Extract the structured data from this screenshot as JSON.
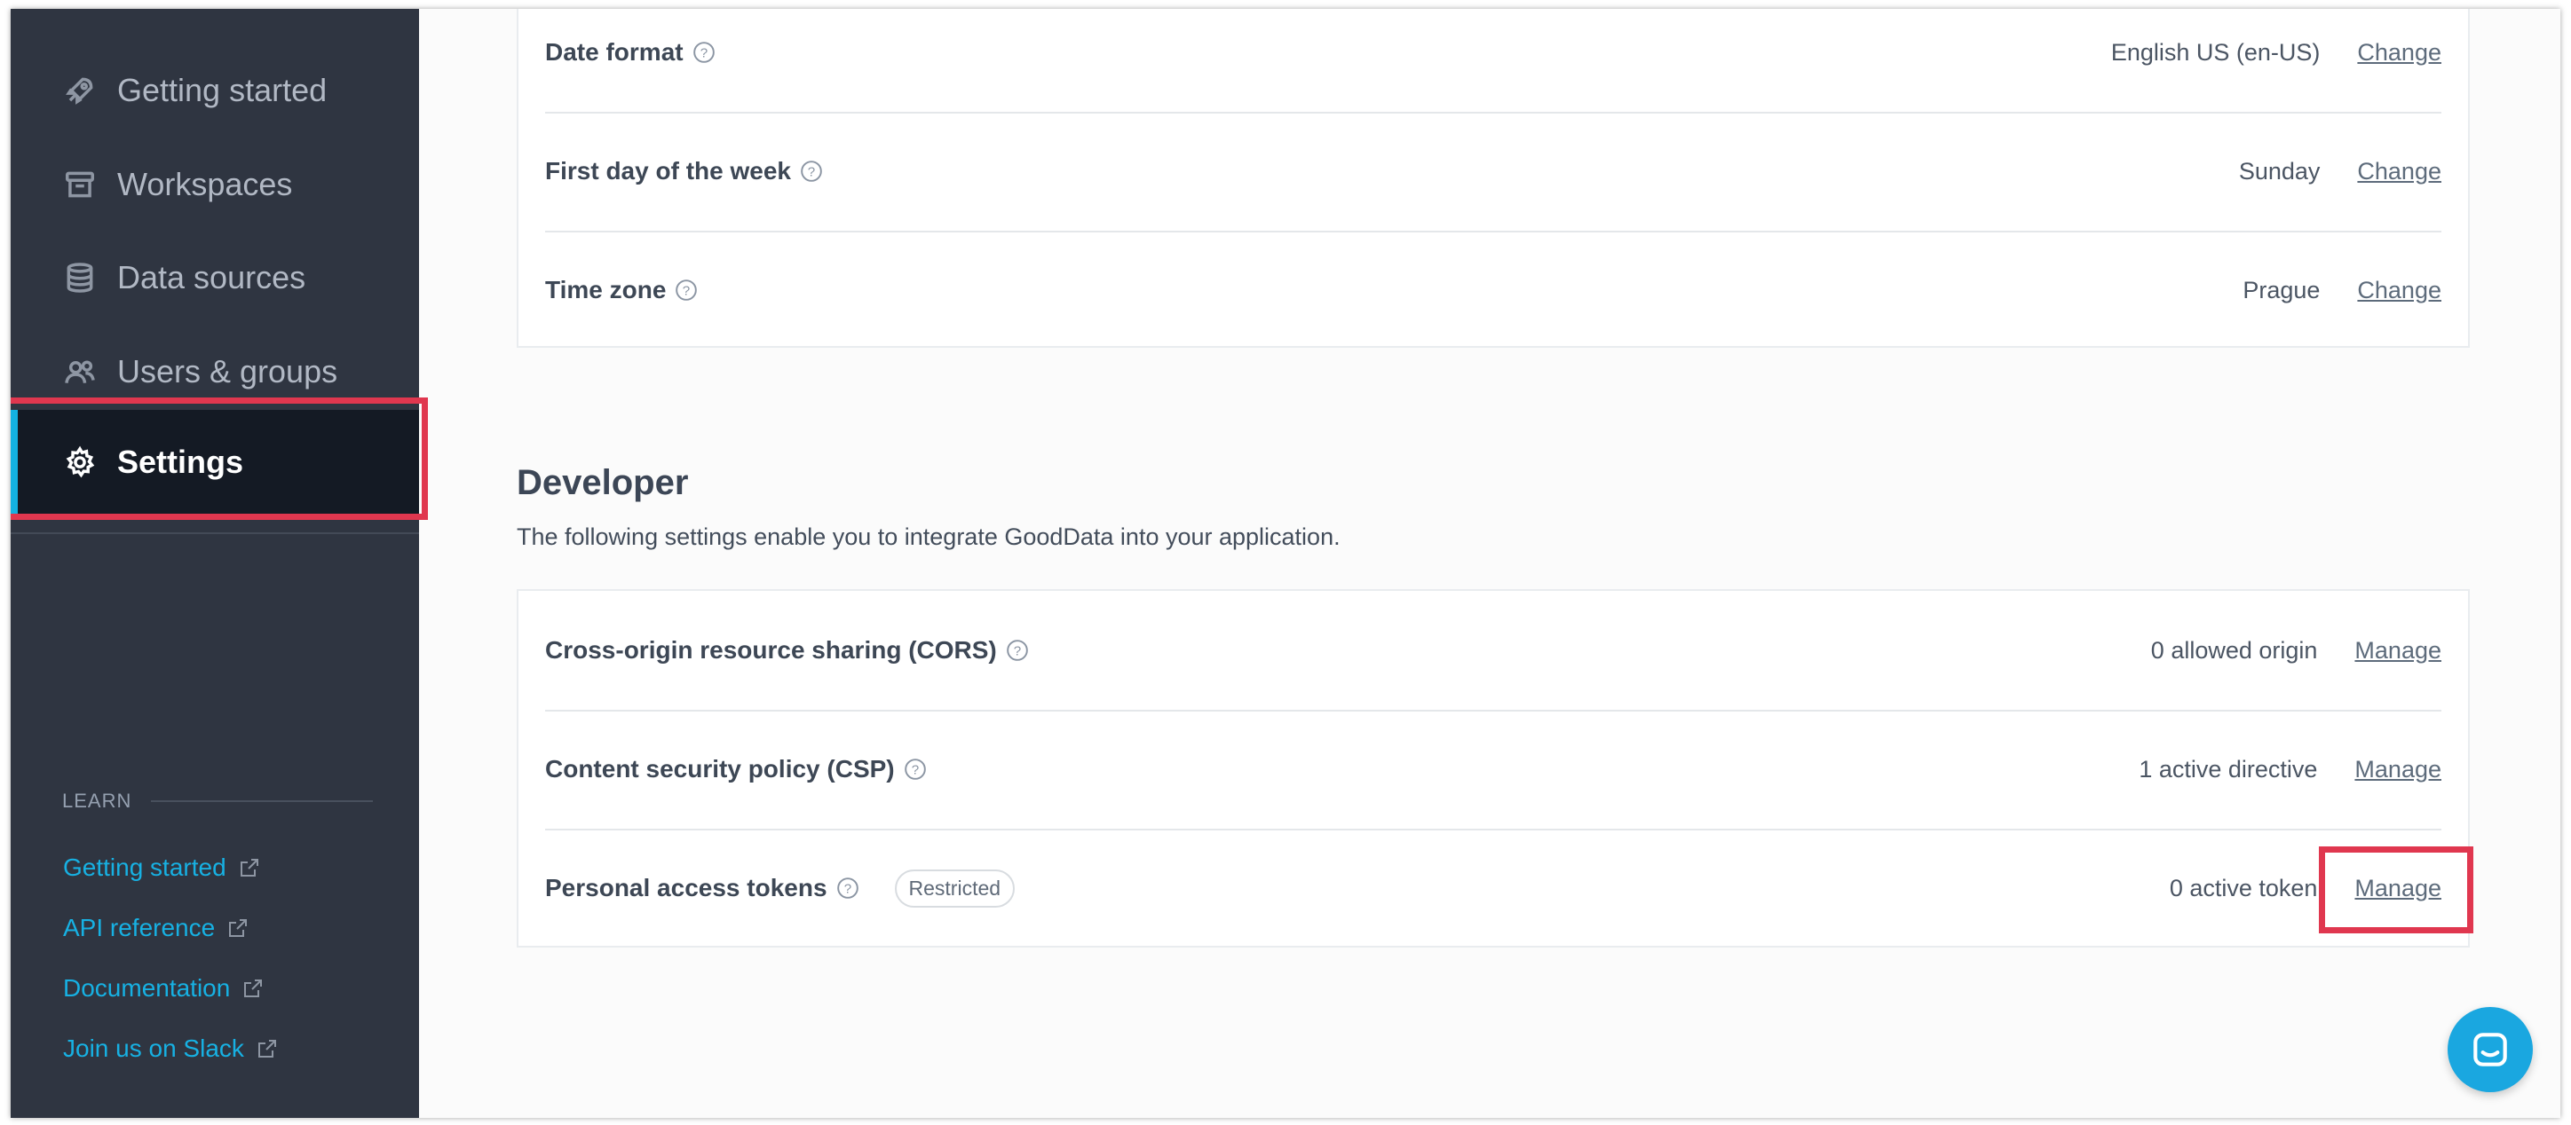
{
  "sidebar": {
    "items": [
      {
        "label": "Getting started",
        "icon": "rocket-icon"
      },
      {
        "label": "Workspaces",
        "icon": "archive-icon"
      },
      {
        "label": "Data sources",
        "icon": "database-icon"
      },
      {
        "label": "Users & groups",
        "icon": "users-icon"
      },
      {
        "label": "Settings",
        "icon": "gear-icon",
        "active": true
      }
    ],
    "learn": {
      "header": "LEARN",
      "links": [
        {
          "label": "Getting started"
        },
        {
          "label": "API reference"
        },
        {
          "label": "Documentation"
        },
        {
          "label": "Join us on Slack"
        }
      ]
    }
  },
  "localization": {
    "rows": [
      {
        "label": "Date format",
        "value": "English US (en-US)",
        "action": "Change"
      },
      {
        "label": "First day of the week",
        "value": "Sunday",
        "action": "Change"
      },
      {
        "label": "Time zone",
        "value": "Prague",
        "action": "Change"
      }
    ]
  },
  "developer": {
    "title": "Developer",
    "description": "The following settings enable you to integrate GoodData into your application.",
    "rows": [
      {
        "label": "Cross-origin resource sharing (CORS)",
        "value": "0 allowed origin",
        "action": "Manage"
      },
      {
        "label": "Content security policy (CSP)",
        "value": "1 active directive",
        "action": "Manage"
      },
      {
        "label": "Personal access tokens",
        "badge": "Restricted",
        "value": "0 active token",
        "action": "Manage"
      }
    ]
  },
  "colors": {
    "sidebar_bg": "#2f3541",
    "active_bg": "#141a24",
    "accent": "#14b2e2",
    "highlight": "#e0374f"
  }
}
